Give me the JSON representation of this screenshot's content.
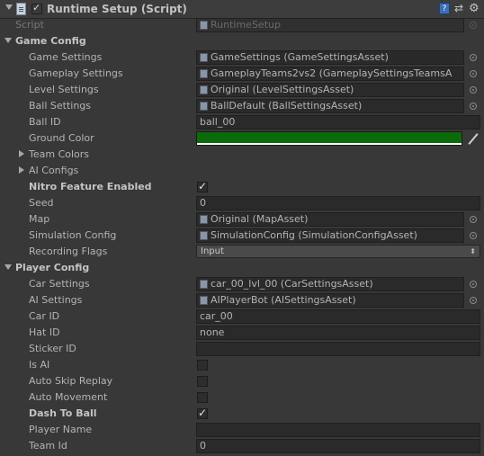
{
  "header": {
    "title": "Runtime Setup (Script)",
    "help_icon": "help-icon",
    "presets_icon": "presets-icon",
    "gear_icon": "gear-icon",
    "enabled": true
  },
  "script": {
    "label": "Script",
    "value": "RuntimeSetup"
  },
  "game_config": {
    "label": "Game Config",
    "game_settings": {
      "label": "Game Settings",
      "value": "GameSettings (GameSettingsAsset)"
    },
    "gameplay_settings": {
      "label": "Gameplay Settings",
      "value": "GameplayTeams2vs2 (GameplaySettingsTeamsA"
    },
    "level_settings": {
      "label": "Level Settings",
      "value": "Original (LevelSettingsAsset)"
    },
    "ball_settings": {
      "label": "Ball Settings",
      "value": "BallDefault (BallSettingsAsset)"
    },
    "ball_id": {
      "label": "Ball ID",
      "value": "ball_00"
    },
    "ground_color": {
      "label": "Ground Color",
      "color": "#0b6b0b"
    },
    "team_colors": {
      "label": "Team Colors"
    },
    "ai_configs": {
      "label": "AI Configs"
    },
    "nitro": {
      "label": "Nitro Feature Enabled",
      "checked": true
    },
    "seed": {
      "label": "Seed",
      "value": "0"
    },
    "map": {
      "label": "Map",
      "value": "Original (MapAsset)"
    },
    "simulation_config": {
      "label": "Simulation Config",
      "value": "SimulationConfig (SimulationConfigAsset)"
    },
    "recording_flags": {
      "label": "Recording Flags",
      "value": "Input"
    }
  },
  "player_config": {
    "label": "Player Config",
    "car_settings": {
      "label": "Car Settings",
      "value": "car_00_lvl_00 (CarSettingsAsset)"
    },
    "ai_settings": {
      "label": "AI Settings",
      "value": "AIPlayerBot (AISettingsAsset)"
    },
    "car_id": {
      "label": "Car ID",
      "value": "car_00"
    },
    "hat_id": {
      "label": "Hat ID",
      "value": "none"
    },
    "sticker_id": {
      "label": "Sticker ID",
      "value": ""
    },
    "is_ai": {
      "label": "Is AI",
      "checked": false
    },
    "auto_skip_replay": {
      "label": "Auto Skip Replay",
      "checked": false
    },
    "auto_movement": {
      "label": "Auto Movement",
      "checked": false
    },
    "dash_to_ball": {
      "label": "Dash To Ball",
      "checked": true
    },
    "player_name": {
      "label": "Player Name",
      "value": ""
    },
    "team_id": {
      "label": "Team Id",
      "value": "0"
    }
  }
}
